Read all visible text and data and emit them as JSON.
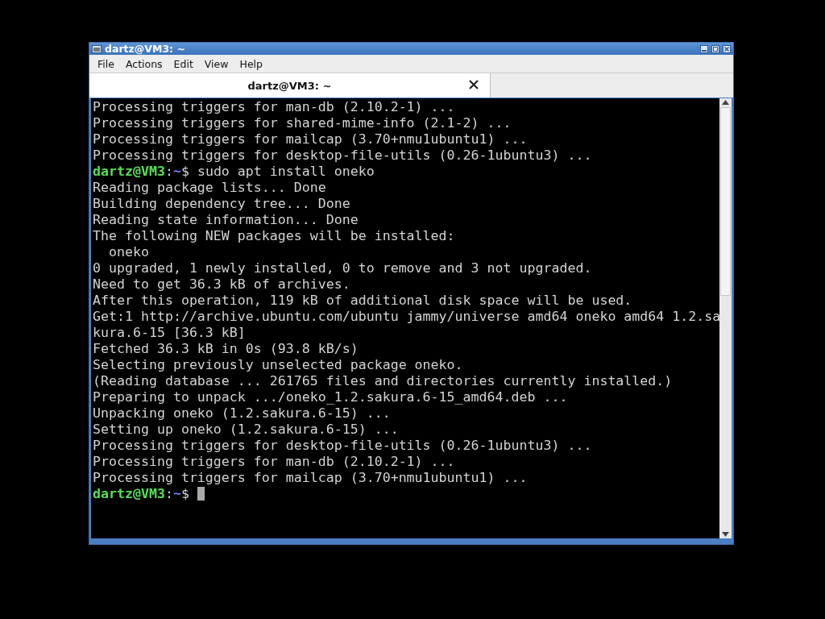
{
  "window": {
    "title": "dartz@VM3: ~"
  },
  "menu": [
    "File",
    "Actions",
    "Edit",
    "View",
    "Help"
  ],
  "tabs": [
    {
      "label": "dartz@VM3: ~",
      "selected": true
    }
  ],
  "terminal": {
    "lines": [
      {
        "kind": "output",
        "text": "Processing triggers for man-db (2.10.2-1) ..."
      },
      {
        "kind": "output",
        "text": "Processing triggers for shared-mime-info (2.1-2) ..."
      },
      {
        "kind": "output",
        "text": "Processing triggers for mailcap (3.70+nmu1ubuntu1) ..."
      },
      {
        "kind": "output",
        "text": "Processing triggers for desktop-file-utils (0.26-1ubuntu3) ..."
      },
      {
        "kind": "prompt",
        "user_host": "dartz@VM3",
        "separator": ":",
        "path": "~",
        "symbol": "$",
        "command": "sudo apt install oneko",
        "cursor": false
      },
      {
        "kind": "output",
        "text": "Reading package lists... Done"
      },
      {
        "kind": "output",
        "text": "Building dependency tree... Done"
      },
      {
        "kind": "output",
        "text": "Reading state information... Done"
      },
      {
        "kind": "output",
        "text": "The following NEW packages will be installed:"
      },
      {
        "kind": "output",
        "text": "  oneko"
      },
      {
        "kind": "output",
        "text": "0 upgraded, 1 newly installed, 0 to remove and 3 not upgraded."
      },
      {
        "kind": "output",
        "text": "Need to get 36.3 kB of archives."
      },
      {
        "kind": "output",
        "text": "After this operation, 119 kB of additional disk space will be used."
      },
      {
        "kind": "output",
        "text": "Get:1 http://archive.ubuntu.com/ubuntu jammy/universe amd64 oneko amd64 1.2.sa"
      },
      {
        "kind": "output",
        "text": "kura.6-15 [36.3 kB]"
      },
      {
        "kind": "output",
        "text": "Fetched 36.3 kB in 0s (93.8 kB/s)"
      },
      {
        "kind": "output",
        "text": "Selecting previously unselected package oneko."
      },
      {
        "kind": "output",
        "text": "(Reading database ... 261765 files and directories currently installed.)"
      },
      {
        "kind": "output",
        "text": "Preparing to unpack .../oneko_1.2.sakura.6-15_amd64.deb ..."
      },
      {
        "kind": "output",
        "text": "Unpacking oneko (1.2.sakura.6-15) ..."
      },
      {
        "kind": "output",
        "text": "Setting up oneko (1.2.sakura.6-15) ..."
      },
      {
        "kind": "output",
        "text": "Processing triggers for desktop-file-utils (0.26-1ubuntu3) ..."
      },
      {
        "kind": "output",
        "text": "Processing triggers for man-db (2.10.2-1) ..."
      },
      {
        "kind": "output",
        "text": "Processing triggers for mailcap (3.70+nmu1ubuntu1) ..."
      },
      {
        "kind": "prompt",
        "user_host": "dartz@VM3",
        "separator": ":",
        "path": "~",
        "symbol": "$",
        "cursor": true
      }
    ]
  }
}
